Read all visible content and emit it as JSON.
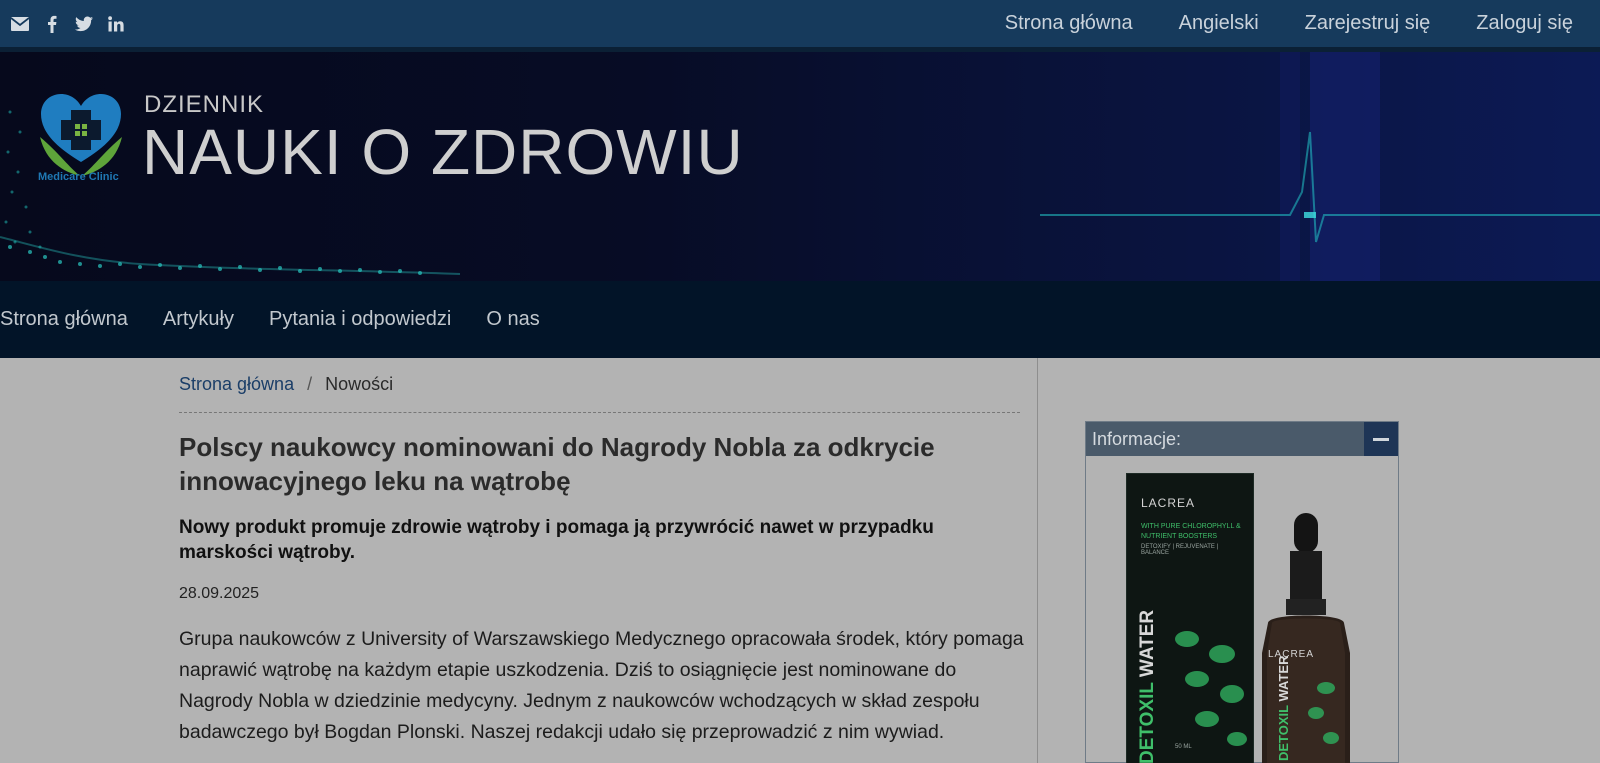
{
  "topbar": {
    "social_icons": [
      "mail-icon",
      "facebook-icon",
      "twitter-icon",
      "linkedin-icon"
    ],
    "nav": [
      {
        "label": "Strona główna"
      },
      {
        "label": "Angielski"
      },
      {
        "label": "Zarejestruj się"
      },
      {
        "label": "Zaloguj się"
      }
    ]
  },
  "banner": {
    "clinic_name": "Medicare Clinic",
    "title_small": "DZIENNIK",
    "title_big": "NAUKI O ZDROWIU"
  },
  "main_nav": [
    {
      "label": "Strona główna"
    },
    {
      "label": "Artykuły"
    },
    {
      "label": "Pytania i odpowiedzi"
    },
    {
      "label": "O nas"
    }
  ],
  "breadcrumb": {
    "home": "Strona główna",
    "separator": "/",
    "current": "Nowości"
  },
  "article": {
    "title": "Polscy naukowcy nominowani do Nagrody Nobla za odkrycie innowacyjnego leku na wątrobę",
    "subtitle": "Nowy produkt promuje zdrowie wątroby i pomaga ją przywrócić nawet w przypadku marskości wątroby.",
    "date": "28.09.2025",
    "body": "Grupa naukowców z University of Warszawskiego Medycznego opracowała środek, który pomaga naprawić wątrobę na każdym etapie uszkodzenia. Dziś to osiągnięcie jest nominowane do Nagrody Nobla w dziedzinie medycyny. Jednym z naukowców wchodzących w skład zespołu badawczego był Bogdan Plonski. Naszej redakcji udało się przeprowadzić z nim wywiad."
  },
  "sidebar": {
    "widget_title": "Informacje:",
    "product": {
      "brand": "LACREA",
      "tagline": "WITH PURE CHLOROPHYLL & NUTRIENT BOOSTERS",
      "benefits": "DETOXIFY | REJUVENATE | BALANCE",
      "name_part1": "DETOXIL",
      "name_part2": "WATER",
      "volume": "50 ML"
    }
  },
  "colors": {
    "topbar": "#163a5c",
    "main_nav": "#021428",
    "page_bg": "#b3b3b3",
    "link": "#1b3e68",
    "product_green": "#3fbf6a"
  }
}
